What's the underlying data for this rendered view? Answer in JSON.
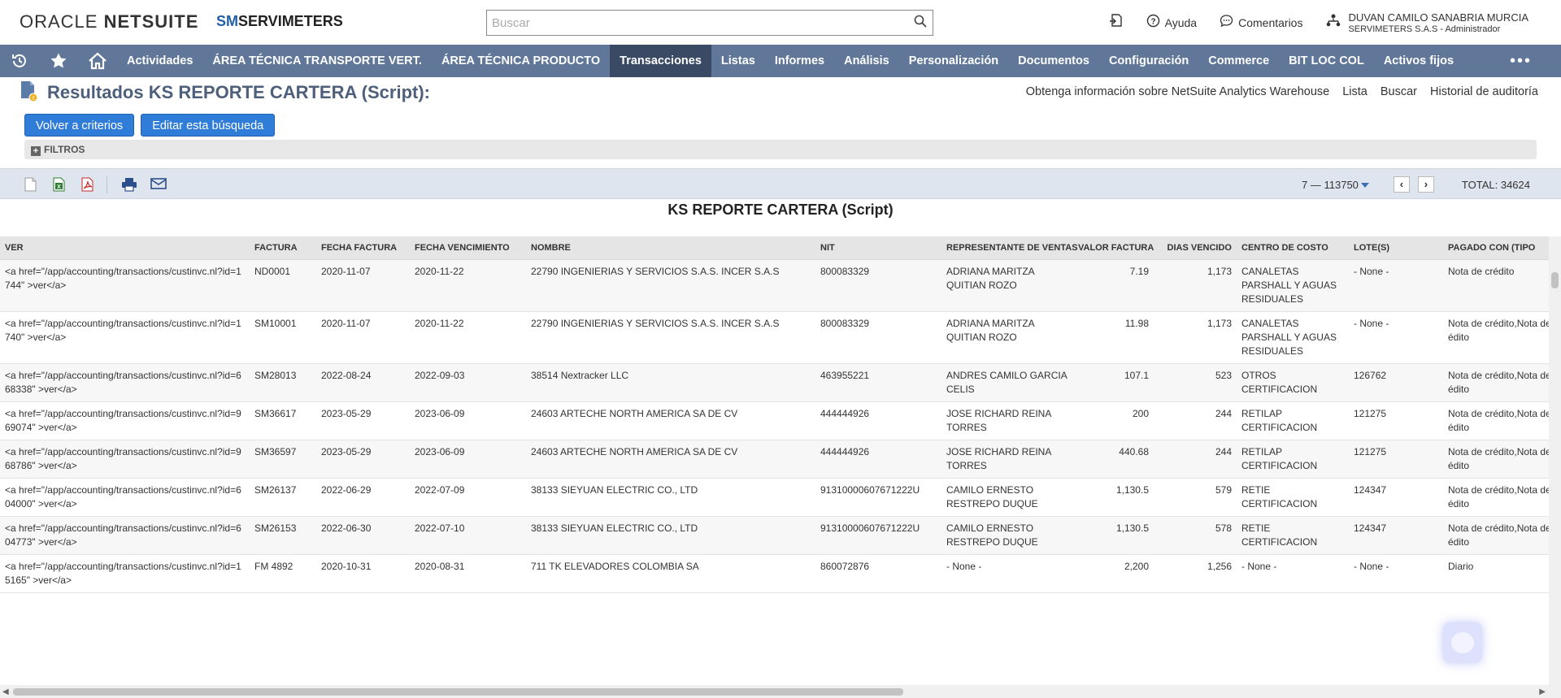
{
  "header": {
    "brand_oracle": "ORACLE",
    "brand_netsuite": "NETSUITE",
    "company_sm": "SM",
    "company_rest": "SERVIMETERS",
    "search_placeholder": "Buscar",
    "help": "Ayuda",
    "feedback": "Comentarios",
    "user_name": "DUVAN CAMILO SANABRIA MURCIA",
    "user_role": "SERVIMETERS S.A.S - Administrador"
  },
  "nav": {
    "items": [
      "Actividades",
      "ÁREA TÉCNICA TRANSPORTE VERT.",
      "ÁREA TÉCNICA PRODUCTO",
      "Transacciones",
      "Listas",
      "Informes",
      "Análisis",
      "Personalización",
      "Documentos",
      "Configuración",
      "Commerce",
      "BIT LOC COL",
      "Activos fijos"
    ],
    "more": "•••"
  },
  "page": {
    "title": "Resultados KS REPORTE CARTERA (Script):",
    "links": [
      "Obtenga información sobre NetSuite Analytics Warehouse",
      "Lista",
      "Buscar",
      "Historial de auditoría"
    ],
    "btn_back": "Volver a criterios",
    "btn_edit": "Editar esta búsqueda",
    "filters": "FILTROS"
  },
  "toolbar": {
    "range": "7 — 113750",
    "total": "TOTAL: 34624"
  },
  "report": {
    "title": "KS REPORTE CARTERA (Script)",
    "headers": [
      "VER",
      "FACTURA",
      "FECHA FACTURA",
      "FECHA VENCIMIENTO",
      "NOMBRE",
      "NIT",
      "REPRESENTANTE DE VENTAS",
      "VALOR FACTURA",
      "DIAS VENCIDO",
      "CENTRO DE COSTO",
      "LOTE(S)",
      "PAGADO CON (TIPO"
    ],
    "rows": [
      [
        "<a href=\"/app/accounting/transactions/custinvc.nl?id=1744\" >ver</a>",
        "ND0001",
        "2020-11-07",
        "2020-11-22",
        "22790 INGENIERIAS Y SERVICIOS S.A.S. INCER S.A.S",
        "800083329",
        "ADRIANA MARITZA QUITIAN ROZO",
        "7.19",
        "1,173",
        "CANALETAS PARSHALL Y AGUAS RESIDUALES",
        "- None -",
        "Nota de crédito"
      ],
      [
        "<a href=\"/app/accounting/transactions/custinvc.nl?id=1740\" >ver</a>",
        "SM10001",
        "2020-11-07",
        "2020-11-22",
        "22790 INGENIERIAS Y SERVICIOS S.A.S. INCER S.A.S",
        "800083329",
        "ADRIANA MARITZA QUITIAN ROZO",
        "11.98",
        "1,173",
        "CANALETAS PARSHALL Y AGUAS RESIDUALES",
        "- None -",
        "Nota de crédito,Nota de crédito"
      ],
      [
        "<a href=\"/app/accounting/transactions/custinvc.nl?id=668338\" >ver</a>",
        "SM28013",
        "2022-08-24",
        "2022-09-03",
        "38514 Nextracker LLC",
        "463955221",
        "ANDRES CAMILO GARCIA CELIS",
        "107.1",
        "523",
        "OTROS CERTIFICACION",
        "126762",
        "Nota de crédito,Nota de crédito"
      ],
      [
        "<a href=\"/app/accounting/transactions/custinvc.nl?id=969074\" >ver</a>",
        "SM36617",
        "2023-05-29",
        "2023-06-09",
        "24603 ARTECHE NORTH AMERICA SA DE CV",
        "444444926",
        "JOSE RICHARD REINA TORRES",
        "200",
        "244",
        "RETILAP CERTIFICACION",
        "121275",
        "Nota de crédito,Nota de crédito"
      ],
      [
        "<a href=\"/app/accounting/transactions/custinvc.nl?id=968786\" >ver</a>",
        "SM36597",
        "2023-05-29",
        "2023-06-09",
        "24603 ARTECHE NORTH AMERICA SA DE CV",
        "444444926",
        "JOSE RICHARD REINA TORRES",
        "440.68",
        "244",
        "RETILAP CERTIFICACION",
        "121275",
        "Nota de crédito,Nota de crédito"
      ],
      [
        "<a href=\"/app/accounting/transactions/custinvc.nl?id=604000\" >ver</a>",
        "SM26137",
        "2022-06-29",
        "2022-07-09",
        "38133 SIEYUAN ELECTRIC CO., LTD",
        "91310000607671222U",
        "CAMILO ERNESTO RESTREPO DUQUE",
        "1,130.5",
        "579",
        "RETIE CERTIFICACION",
        "124347",
        "Nota de crédito,Nota de crédito"
      ],
      [
        "<a href=\"/app/accounting/transactions/custinvc.nl?id=604773\" >ver</a>",
        "SM26153",
        "2022-06-30",
        "2022-07-10",
        "38133 SIEYUAN ELECTRIC CO., LTD",
        "91310000607671222U",
        "CAMILO ERNESTO RESTREPO DUQUE",
        "1,130.5",
        "578",
        "RETIE CERTIFICACION",
        "124347",
        "Nota de crédito,Nota de crédito"
      ],
      [
        "<a href=\"/app/accounting/transactions/custinvc.nl?id=15165\" >ver</a>",
        "FM 4892",
        "2020-10-31",
        "2020-08-31",
        "711 TK ELEVADORES COLOMBIA SA",
        "860072876",
        "- None -",
        "2,200",
        "1,256",
        "- None -",
        "- None -",
        "Diario"
      ]
    ]
  }
}
